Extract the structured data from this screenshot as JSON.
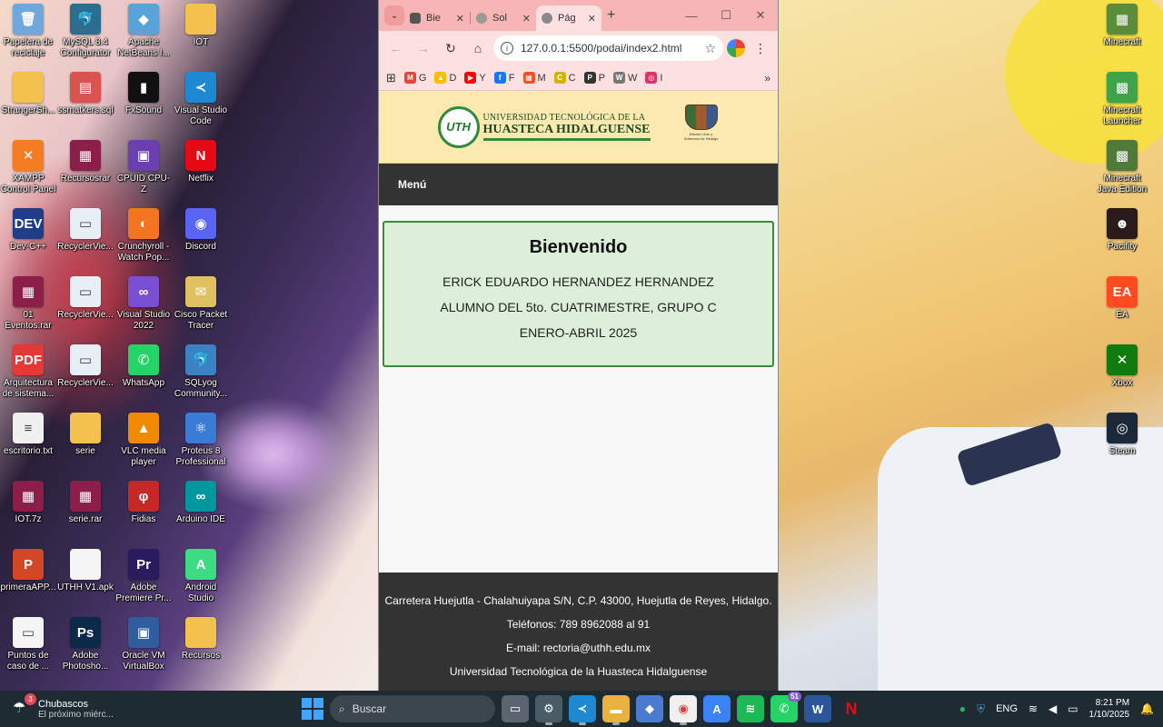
{
  "desktop": {
    "left_icons": [
      {
        "label": "Papelera de reciclaje",
        "glyph": "🗑",
        "color": "#6fa8dc",
        "icon": "recycle-bin-icon"
      },
      {
        "label": "MySQL 8.4 Configurator",
        "glyph": "🐬",
        "color": "#2c6e8f",
        "icon": "mysql-icon"
      },
      {
        "label": "Apache NetBeans I...",
        "glyph": "◆",
        "color": "#5aa3d8",
        "icon": "netbeans-icon"
      },
      {
        "label": "IOT",
        "glyph": "",
        "color": "#f2c14e",
        "icon": "folder-icon"
      },
      {
        "label": "StrangerSh...",
        "glyph": "",
        "color": "#f2c14e",
        "icon": "folder-icon"
      },
      {
        "label": "ssmatkers.sql",
        "glyph": "▤",
        "color": "#d9534f",
        "icon": "sql-file-icon"
      },
      {
        "label": "FxSound",
        "glyph": "▮",
        "color": "#111111",
        "icon": "fxsound-icon"
      },
      {
        "label": "Visual Studio Code",
        "glyph": "≺",
        "color": "#1e88d2",
        "icon": "vscode-icon"
      },
      {
        "label": "XAMPP Control Panel",
        "glyph": "✕",
        "color": "#f57c20",
        "icon": "xampp-icon"
      },
      {
        "label": "Recursosrar",
        "glyph": "▦",
        "color": "#8b1f4a",
        "icon": "winrar-icon"
      },
      {
        "label": "CPUID CPU-Z",
        "glyph": "▣",
        "color": "#6c3fb0",
        "icon": "cpuz-icon"
      },
      {
        "label": "Netflix",
        "glyph": "N",
        "color": "#e50914",
        "icon": "netflix-icon"
      },
      {
        "label": "Dev-C++",
        "glyph": "DEV",
        "color": "#1f3e8a",
        "icon": "devcpp-icon"
      },
      {
        "label": "RecyclerVie...",
        "glyph": "▭",
        "color": "#e8eef5",
        "icon": "image-file-icon"
      },
      {
        "label": "Crunchyroll - Watch Pop...",
        "glyph": "◐",
        "color": "#f47521",
        "icon": "crunchyroll-icon"
      },
      {
        "label": "Discord",
        "glyph": "◉",
        "color": "#5865f2",
        "icon": "discord-icon"
      },
      {
        "label": "01 Eventos.rar",
        "glyph": "▦",
        "color": "#8b1f4a",
        "icon": "winrar-icon"
      },
      {
        "label": "RecyclerVie...",
        "glyph": "▭",
        "color": "#e8eef5",
        "icon": "image-file-icon"
      },
      {
        "label": "Visual Studio 2022",
        "glyph": "∞",
        "color": "#7b4fd1",
        "icon": "visual-studio-icon"
      },
      {
        "label": "Cisco Packet Tracer",
        "glyph": "✉",
        "color": "#e0c060",
        "icon": "packet-tracer-icon"
      },
      {
        "label": "Arquitectura de sistema...",
        "glyph": "PDF",
        "color": "#e53935",
        "icon": "pdf-file-icon"
      },
      {
        "label": "RecyclerVie...",
        "glyph": "▭",
        "color": "#e8eef5",
        "icon": "image-file-icon"
      },
      {
        "label": "WhatsApp",
        "glyph": "✆",
        "color": "#25d366",
        "icon": "whatsapp-icon"
      },
      {
        "label": "SQLyog Community...",
        "glyph": "🐬",
        "color": "#3b82c4",
        "icon": "sqlyog-icon"
      },
      {
        "label": "escritorio.txt",
        "glyph": "≡",
        "color": "#f0f0f0",
        "icon": "text-file-icon"
      },
      {
        "label": "serie",
        "glyph": "",
        "color": "#f2c14e",
        "icon": "folder-icon"
      },
      {
        "label": "VLC media player",
        "glyph": "▲",
        "color": "#f08a00",
        "icon": "vlc-icon"
      },
      {
        "label": "Proteus 8 Professional",
        "glyph": "⚛",
        "color": "#3a7bd5",
        "icon": "proteus-icon"
      },
      {
        "label": "IOT.7z",
        "glyph": "▦",
        "color": "#8b1f4a",
        "icon": "winrar-icon"
      },
      {
        "label": "serie.rar",
        "glyph": "▦",
        "color": "#8b1f4a",
        "icon": "winrar-icon"
      },
      {
        "label": "Fidias",
        "glyph": "φ",
        "color": "#c62828",
        "icon": "fidias-icon"
      },
      {
        "label": "Arduino IDE",
        "glyph": "∞",
        "color": "#00979d",
        "icon": "arduino-icon"
      },
      {
        "label": "primeraAPP...",
        "glyph": "P",
        "color": "#d24726",
        "icon": "powerpoint-file-icon"
      },
      {
        "label": "UTHH V1.apk",
        "glyph": "",
        "color": "#f5f5f5",
        "icon": "apk-file-icon"
      },
      {
        "label": "Adobe Premiere Pr...",
        "glyph": "Pr",
        "color": "#2a1a5e",
        "icon": "premiere-icon"
      },
      {
        "label": "Android Studio",
        "glyph": "A",
        "color": "#3ddc84",
        "icon": "android-studio-icon"
      },
      {
        "label": "Puntos de caso de ...",
        "glyph": "▭",
        "color": "#f5f5f5",
        "icon": "document-file-icon"
      },
      {
        "label": "Adobe Photosho...",
        "glyph": "Ps",
        "color": "#0b2a4a",
        "icon": "photoshop-icon"
      },
      {
        "label": "Oracle VM VirtualBox",
        "glyph": "▣",
        "color": "#2f5d9e",
        "icon": "virtualbox-icon"
      },
      {
        "label": "Recursos",
        "glyph": "",
        "color": "#f2c14e",
        "icon": "folder-icon"
      }
    ],
    "right_icons": [
      {
        "label": "Minecraft",
        "glyph": "▦",
        "color": "#5b8c3a",
        "icon": "minecraft-icon"
      },
      {
        "label": "Minecraft Launcher",
        "glyph": "▩",
        "color": "#3ea44a",
        "icon": "minecraft-launcher-icon"
      },
      {
        "label": "Minecraft Java Edition",
        "glyph": "▩",
        "color": "#4f7a3a",
        "icon": "minecraft-java-icon"
      },
      {
        "label": "Pacifity",
        "glyph": "☻",
        "color": "#2b1a1a",
        "icon": "pacifity-icon"
      },
      {
        "label": "EA",
        "glyph": "EA",
        "color": "#ff4b1f",
        "icon": "ea-icon"
      },
      {
        "label": "Xbox",
        "glyph": "✕",
        "color": "#107c10",
        "icon": "xbox-icon"
      },
      {
        "label": "Steam",
        "glyph": "◎",
        "color": "#1b2838",
        "icon": "steam-icon"
      }
    ]
  },
  "browser": {
    "tabs": [
      {
        "label": "Bie",
        "active": false
      },
      {
        "label": "Sol",
        "active": false
      },
      {
        "label": "Pág",
        "active": true
      }
    ],
    "url": "127.0.0.1:5500/podai/index2.html",
    "bookmarks": [
      {
        "label": "G",
        "badge": "M",
        "color": "#ea4335"
      },
      {
        "label": "D",
        "badge": "▲",
        "color": "#fbbc04"
      },
      {
        "label": "Y",
        "badge": "▶",
        "color": "#ff0000"
      },
      {
        "label": "F",
        "badge": "f",
        "color": "#1877f2"
      },
      {
        "label": "M",
        "badge": "▦",
        "color": "#f25022"
      },
      {
        "label": "C",
        "badge": "C",
        "color": "#d4b400"
      },
      {
        "label": "P",
        "badge": "P",
        "color": "#333333"
      },
      {
        "label": "W",
        "badge": "W",
        "color": "#777777"
      },
      {
        "label": "I",
        "badge": "◎",
        "color": "#e1306c"
      }
    ]
  },
  "page": {
    "logo_line1": "UNIVERSIDAD TECNOLÓGICA DE LA",
    "logo_line2": "HUASTECA HIDALGUENSE",
    "logo_mark": "UTH",
    "crest_text": "Estado Libre y Soberano de Hidalgo",
    "nav_menu": "Menú",
    "welcome": {
      "title": "Bienvenido",
      "name": "ERICK EDUARDO HERNANDEZ HERNANDEZ",
      "group": "ALUMNO DEL 5to. CUATRIMESTRE, GRUPO C",
      "period": "ENERO-ABRIL 2025"
    },
    "footer": {
      "address": "Carretera Huejutla - Chalahuiyapa S/N, C.P. 43000, Huejutla de Reyes, Hidalgo.",
      "phones": "Teléfonos: 789 8962088 al 91",
      "email": "E-mail: rectoria@uthh.edu.mx",
      "institution": "Universidad Tecnológica de la Huasteca Hidalguense"
    }
  },
  "taskbar": {
    "weather_title": "Chubascos",
    "weather_sub": "El próximo miérc...",
    "weather_badge": "3",
    "search_placeholder": "Buscar",
    "whatsapp_badge": "51",
    "language": "ENG",
    "time": "8:21 PM",
    "date": "1/10/2025"
  }
}
